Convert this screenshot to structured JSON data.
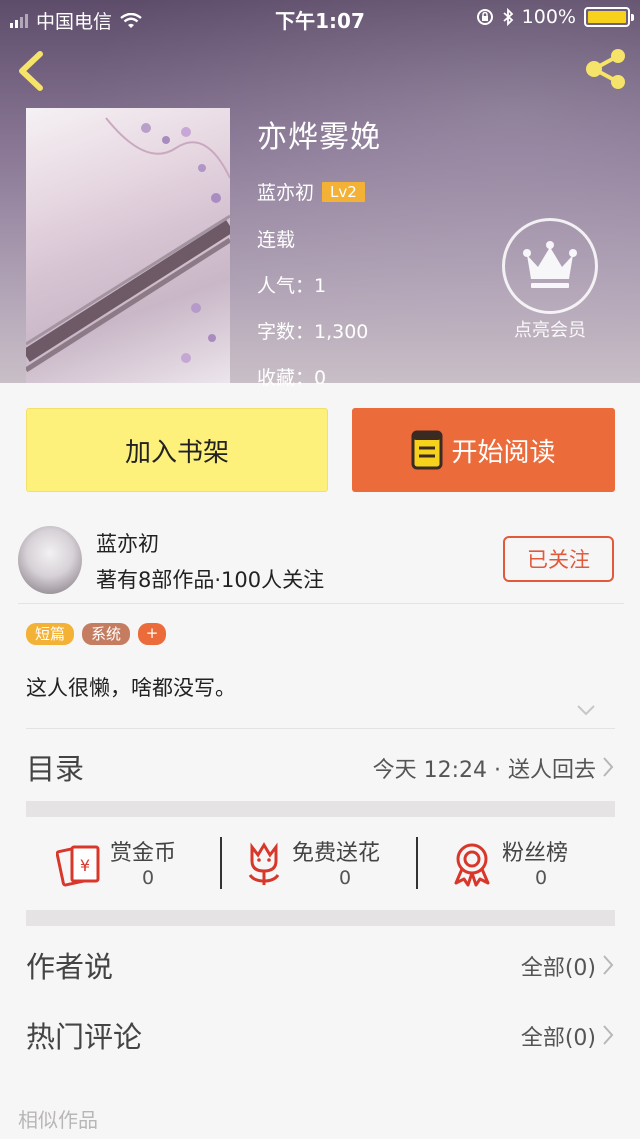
{
  "status_bar": {
    "carrier": "中国电信",
    "time": "下午1:07",
    "battery": "100%"
  },
  "book": {
    "title": "亦烨雾娩",
    "author": "蓝亦初",
    "author_level": "Lv2",
    "status": "连载",
    "popularity": "人气：1",
    "word_count": "字数：1,300",
    "favorites": "收藏：0"
  },
  "vip": {
    "label": "点亮会员"
  },
  "actions": {
    "add_shelf": "加入书架",
    "start_read": "开始阅读"
  },
  "author_card": {
    "name": "蓝亦初",
    "stats": "著有8部作品·100人关注",
    "follow_label": "已关注"
  },
  "tags": [
    "短篇",
    "系统",
    "+"
  ],
  "description": "这人很懒，啥都没写。",
  "catalog": {
    "label": "目录",
    "latest": "今天 12:24 · 送人回去"
  },
  "rewards": [
    {
      "label": "赏金币",
      "count": "0",
      "icon": "red-envelope-icon"
    },
    {
      "label": "免费送花",
      "count": "0",
      "icon": "flower-icon"
    },
    {
      "label": "粉丝榜",
      "count": "0",
      "icon": "medal-icon"
    }
  ],
  "author_says": {
    "label": "作者说",
    "value": "全部(0)"
  },
  "hot_comments": {
    "label": "热门评论",
    "value": "全部(0)"
  },
  "similar": {
    "label": "相似作品"
  },
  "colors": {
    "accent_orange": "#ec6b3a",
    "shelf_yellow": "#fdf17c",
    "level_badge": "#f3b136",
    "follow_red": "#e05a3b"
  }
}
